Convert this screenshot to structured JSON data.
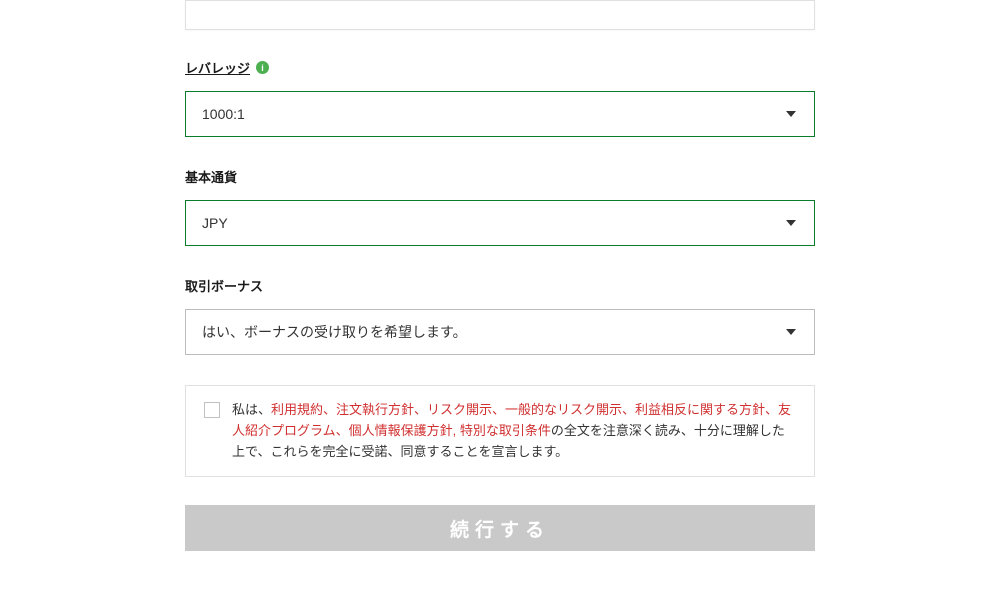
{
  "leverage": {
    "label": "レバレッジ",
    "value": "1000:1"
  },
  "base_currency": {
    "label": "基本通貨",
    "value": "JPY"
  },
  "trading_bonus": {
    "label": "取引ボーナス",
    "value": "はい、ボーナスの受け取りを希望します。"
  },
  "agreement": {
    "prefix": "私は、",
    "links": "利用規約、注文執行方針、リスク開示、一般的なリスク開示、利益相反に関する方針、友人紹介プログラム、個人情報保護方針, 特別な取引条件",
    "suffix": "の全文を注意深く読み、十分に理解した上で、これらを完全に受諾、同意することを宣言します。"
  },
  "continue_button": "続行する"
}
